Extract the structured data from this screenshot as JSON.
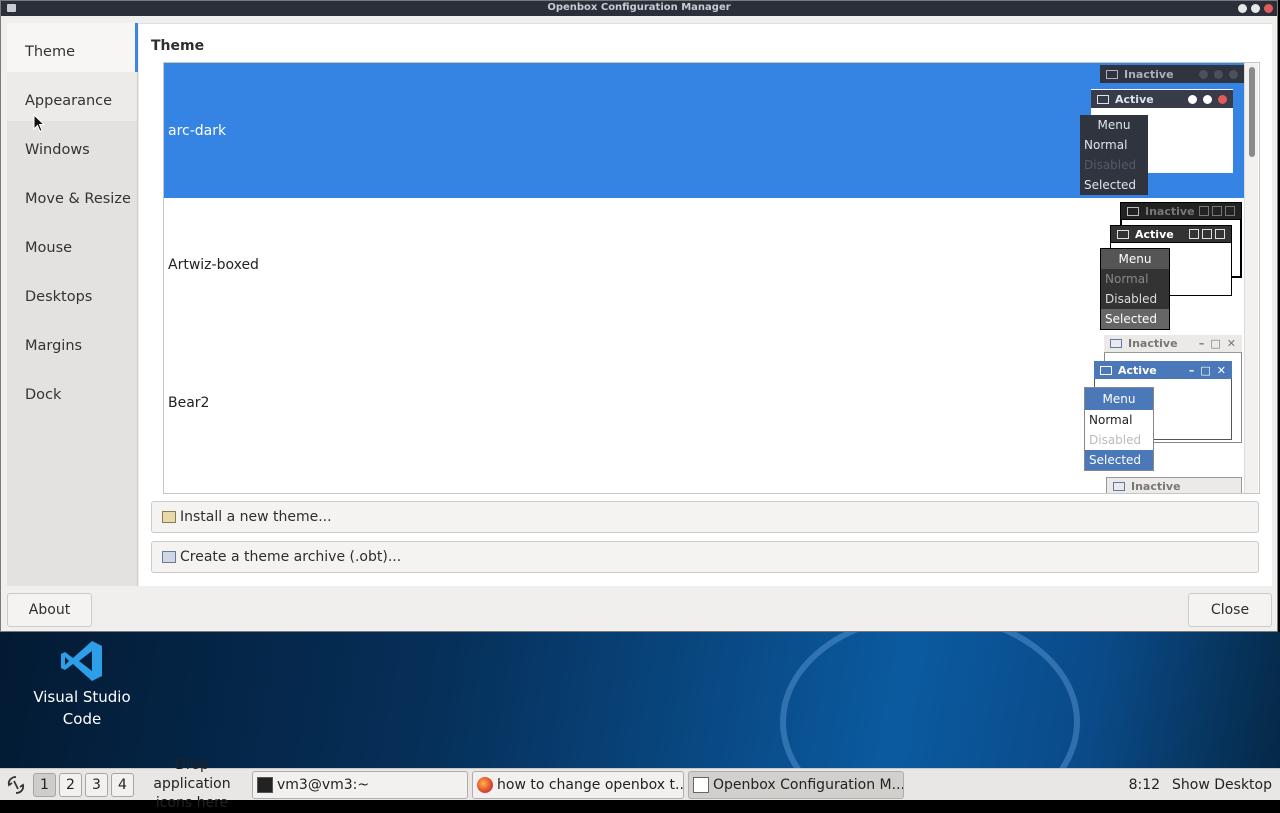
{
  "window": {
    "title": "Openbox Configuration Manager"
  },
  "sidebar": {
    "items": [
      {
        "label": "Theme"
      },
      {
        "label": "Appearance"
      },
      {
        "label": "Windows"
      },
      {
        "label": "Move & Resize"
      },
      {
        "label": "Mouse"
      },
      {
        "label": "Desktops"
      },
      {
        "label": "Margins"
      },
      {
        "label": "Dock"
      }
    ]
  },
  "content": {
    "section_title": "Theme",
    "themes": [
      {
        "name": "arc-dark",
        "selected": true
      },
      {
        "name": "Artwiz-boxed",
        "selected": false
      },
      {
        "name": "Bear2",
        "selected": false
      }
    ],
    "preview": {
      "inactive": "Inactive",
      "active": "Active",
      "menu": "Menu",
      "normal": "Normal",
      "disabled": "Disabled",
      "selected": "Selected"
    },
    "install_button": "Install a new theme...",
    "archive_button": "Create a theme archive (.obt)..."
  },
  "footer": {
    "about": "About",
    "close": "Close"
  },
  "desktop": {
    "icon_label_line1": "Visual Studio",
    "icon_label_line2": "Code"
  },
  "taskbar": {
    "workspaces": [
      "1",
      "2",
      "3",
      "4"
    ],
    "drop_line1": "Drop application",
    "drop_line2": "icons here",
    "tasks": [
      {
        "label": "vm3@vm3:~"
      },
      {
        "label": "how to change openbox t..."
      },
      {
        "label": "Openbox Configuration M..."
      }
    ],
    "clock": "8:12",
    "show_desktop": "Show Desktop"
  },
  "colors": {
    "selection": "#3584e4",
    "titlebar": "#2a2f3a"
  }
}
